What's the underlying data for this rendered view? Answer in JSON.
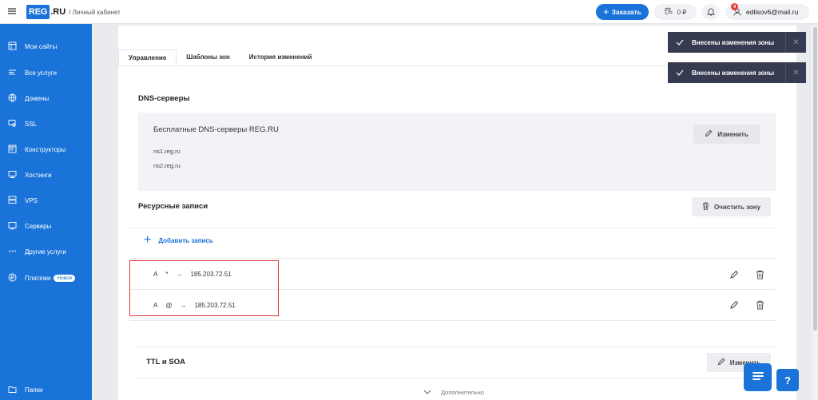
{
  "header": {
    "logo_reg": "REG",
    "logo_ru": ".RU",
    "cabinet_label": "/ Личный кабинет",
    "order_label": "Заказать",
    "balance": "0 ₽",
    "notifications_count": "4",
    "user_email": "edlisov6@mail.ru"
  },
  "sidebar": {
    "items": [
      {
        "label": "Мои сайты",
        "icon": "sites-icon"
      },
      {
        "label": "Все услуги",
        "icon": "list-icon"
      },
      {
        "label": "Домены",
        "icon": "globe-icon"
      },
      {
        "label": "SSL",
        "icon": "certificate-icon"
      },
      {
        "label": "Конструкторы",
        "icon": "builder-icon"
      },
      {
        "label": "Хостинги",
        "icon": "hosting-icon"
      },
      {
        "label": "VPS",
        "icon": "vps-icon"
      },
      {
        "label": "Серверы",
        "icon": "server-icon"
      },
      {
        "label": "Другие услуги",
        "icon": "dots-icon"
      },
      {
        "label": "Платежи",
        "icon": "payments-icon",
        "badge": "Новое"
      }
    ],
    "bottom_item": {
      "label": "Папки",
      "icon": "folder-icon"
    }
  },
  "tabs": [
    {
      "label": "Управление",
      "active": true
    },
    {
      "label": "Шаблоны зон",
      "active": false
    },
    {
      "label": "История изменений",
      "active": false
    }
  ],
  "dns": {
    "title": "DNS-серверы",
    "provider": "Бесплатные DNS-серверы REG.RU",
    "servers": [
      "ns1.reg.ru",
      "ns2.reg.ru"
    ],
    "change_label": "Изменить"
  },
  "records": {
    "title": "Ресурсные записи",
    "clear_label": "Очистить зону",
    "add_label": "Добавить запись",
    "rows": [
      {
        "type": "A",
        "host": "*",
        "arrow": "→",
        "value": "185.203.72.51"
      },
      {
        "type": "A",
        "host": "@",
        "arrow": "→",
        "value": "185.203.72.51"
      }
    ]
  },
  "ttl": {
    "title": "TTL и SOA",
    "change_label": "Изменить",
    "details_label": "Дополнительно"
  },
  "toasts": [
    {
      "text": "Внесены изменения зоны"
    },
    {
      "text": "Внесены изменения зоны"
    }
  ],
  "help_label": "?",
  "colors": {
    "brand": "#1a73d8",
    "toast": "#363b52",
    "highlight": "#d93838"
  }
}
